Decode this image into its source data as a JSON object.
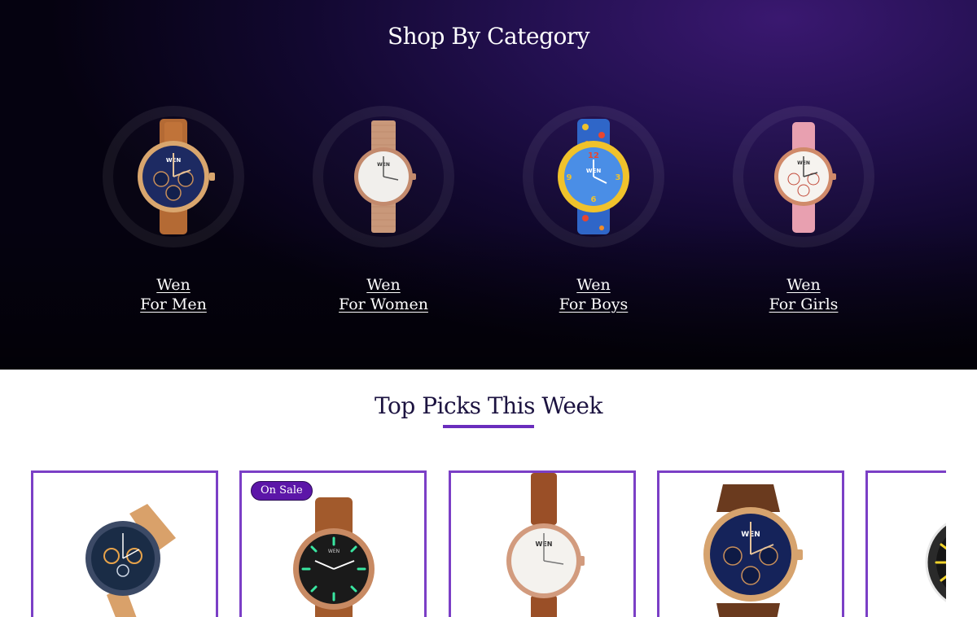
{
  "category_section": {
    "title": "Shop By Category",
    "items": [
      {
        "brand": "Wen",
        "label": "For Men"
      },
      {
        "brand": "Wen",
        "label": "For Women"
      },
      {
        "brand": "Wen",
        "label": "For Boys"
      },
      {
        "brand": "Wen",
        "label": "For Girls"
      }
    ]
  },
  "top_picks": {
    "title": "Top Picks This Week",
    "products": [
      {
        "image": "smartwatch-icon",
        "badge": ""
      },
      {
        "image": "luminous-watch-icon",
        "badge": "On Sale"
      },
      {
        "image": "womens-watch-icon",
        "badge": ""
      },
      {
        "image": "chronograph-watch-icon",
        "badge": ""
      },
      {
        "image": "sport-watch-icon",
        "badge": ""
      }
    ]
  },
  "colors": {
    "accent": "#7b3fc6",
    "badge": "#5c16a8",
    "heading_dark": "#1c1340",
    "hero_bg": "#231050"
  }
}
